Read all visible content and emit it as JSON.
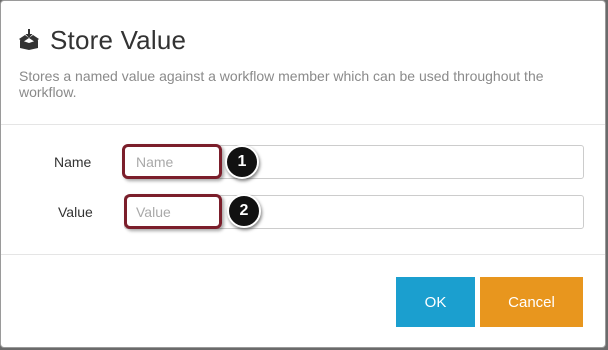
{
  "dialog": {
    "title": "Store Value",
    "title_icon": "box-store-icon",
    "description": "Stores a named value against a workflow member which can be used throughout the workflow."
  },
  "form": {
    "fields": [
      {
        "label": "Name",
        "placeholder": "Name",
        "value": "",
        "callout": "1"
      },
      {
        "label": "Value",
        "placeholder": "Value",
        "value": "",
        "callout": "2"
      }
    ]
  },
  "footer": {
    "ok_label": "OK",
    "cancel_label": "Cancel"
  },
  "colors": {
    "ok_button": "#1b9fcf",
    "cancel_button": "#e8961e",
    "highlight_border": "#7b1e2b",
    "callout_bg": "#111111"
  }
}
